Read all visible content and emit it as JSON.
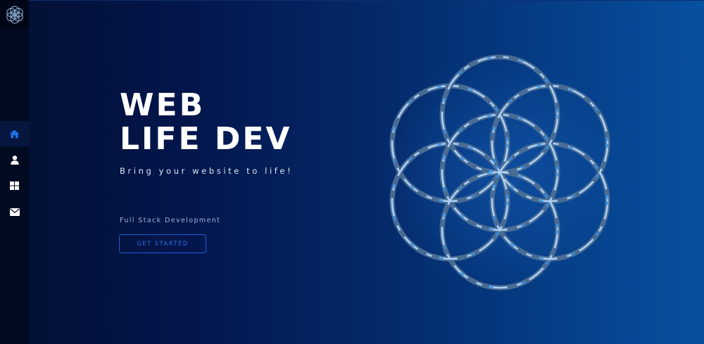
{
  "sidebar": {
    "logo": {
      "icon": "flower-of-life-logo-icon"
    },
    "items": [
      {
        "icon": "home-icon",
        "active": true
      },
      {
        "icon": "user-icon",
        "active": false
      },
      {
        "icon": "grid-icon",
        "active": false
      },
      {
        "icon": "envelope-icon",
        "active": false
      }
    ]
  },
  "hero": {
    "title_line1": "WEB",
    "title_line2": "LIFE DEV",
    "subtitle": "Bring your website to life!",
    "tagline": "Full Stack Development",
    "cta_label": "GET STARTED"
  },
  "artwork": {
    "icon": "flower-of-life-icon"
  },
  "colors": {
    "background_start": "#031033",
    "background_end": "#0750a0",
    "sidebar": "#020a22",
    "accent": "#1e5ad6",
    "active_icon": "#1f6fe0",
    "icon": "#ffffff"
  }
}
